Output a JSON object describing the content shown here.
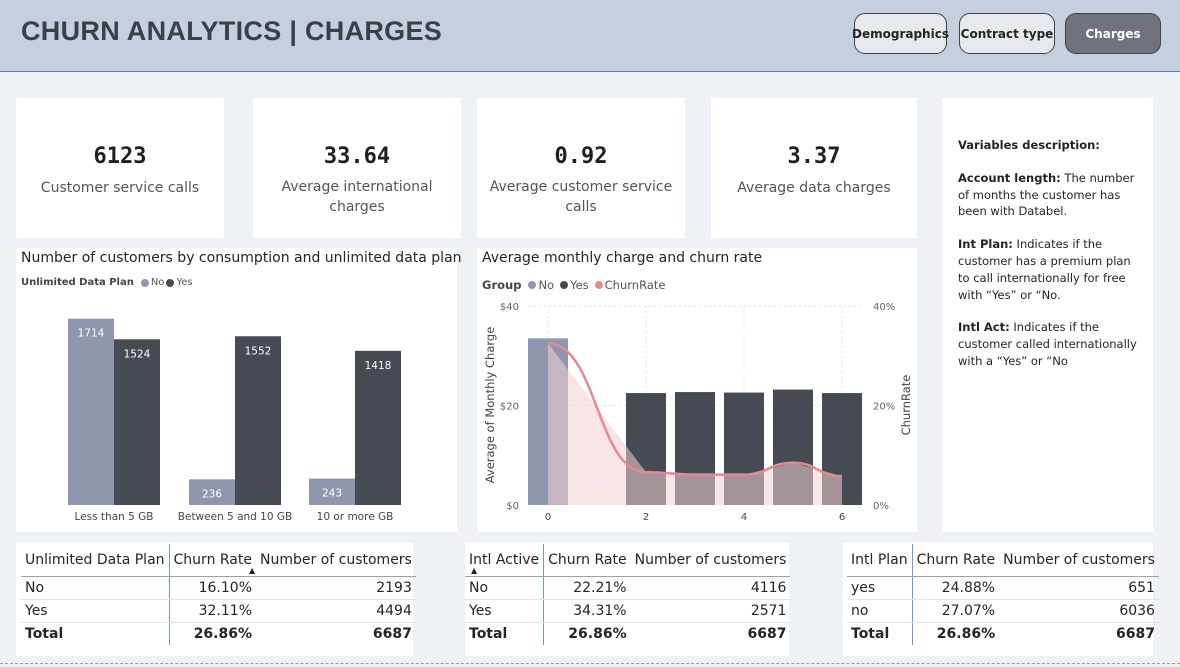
{
  "header": {
    "title": "CHURN ANALYTICS | CHARGES",
    "nav": [
      {
        "label": "Demographics",
        "active": false
      },
      {
        "label": "Contract type",
        "active": false
      },
      {
        "label": "Charges",
        "active": true
      }
    ]
  },
  "kpis": [
    {
      "value": "6123",
      "label": "Customer service calls"
    },
    {
      "value": "33.64",
      "label": "Average international charges"
    },
    {
      "value": "0.92",
      "label": "Average customer service calls"
    },
    {
      "value": "3.37",
      "label": "Average data charges"
    }
  ],
  "description": {
    "heading": "Variables description:",
    "items": [
      {
        "term": "Account length:",
        "text": " The number of months the customer has been with Databel."
      },
      {
        "term": "Int Plan:",
        "text": " Indicates if the customer has a premium plan to call internationally for free with “Yes” or “No."
      },
      {
        "term": "Intl Act:",
        "text": " Indicates if the customer called internationally with a “Yes” or “No"
      }
    ]
  },
  "colors": {
    "no": "#8e97ad",
    "yes": "#464a53",
    "churn_line": "#e8898e",
    "churn_area": "#f3cfd1"
  },
  "chart_data": [
    {
      "type": "bar",
      "title": "Number of customers by consumption and unlimited data plan",
      "legend_title": "Unlimited Data Plan",
      "legend_position": "top-left",
      "categories": [
        "Less than 5 GB",
        "Between 5 and 10 GB",
        "10 or more GB"
      ],
      "series": [
        {
          "name": "No",
          "values": [
            1714,
            236,
            243
          ]
        },
        {
          "name": "Yes",
          "values": [
            1524,
            1552,
            1418
          ]
        }
      ],
      "ylim": [
        0,
        1950
      ],
      "grid": false
    },
    {
      "type": "bar",
      "title": "Average monthly charge and churn rate",
      "legend_title": "Group",
      "legend_position": "top-left",
      "ylabel": "Average of Monthly Charge",
      "y2label": "ChurnRate",
      "x_ticks": [
        "0",
        "2",
        "4",
        "6"
      ],
      "y_ticks": [
        "$0",
        "$20",
        "$40"
      ],
      "y2_ticks": [
        "0%",
        "20%",
        "40%"
      ],
      "x": [
        0,
        2,
        3,
        4,
        5,
        6
      ],
      "series": [
        {
          "name": "No",
          "x": [
            0
          ],
          "values": [
            33.5
          ]
        },
        {
          "name": "Yes",
          "x": [
            2,
            3,
            4,
            5,
            6
          ],
          "values": [
            22.5,
            22.7,
            22.6,
            23.2,
            22.5
          ]
        },
        {
          "name": "ChurnRate",
          "type": "area-line",
          "axis": "secondary",
          "x": [
            0,
            2,
            3,
            4,
            5,
            6
          ],
          "values": [
            32.5,
            6.6,
            6.1,
            6.1,
            8.5,
            5.8
          ]
        }
      ],
      "ylim": [
        0,
        40
      ],
      "y2lim": [
        0,
        40
      ],
      "grid": true
    }
  ],
  "tables": [
    {
      "columns": [
        "Unlimited Data Plan",
        "Churn Rate",
        "Number of customers"
      ],
      "rows": [
        [
          "No",
          "16.10%",
          "2193"
        ],
        [
          "Yes",
          "32.11%",
          "4494"
        ]
      ],
      "total": [
        "Total",
        "26.86%",
        "6687"
      ]
    },
    {
      "columns": [
        "Intl Active",
        "Churn Rate",
        "Number of customers"
      ],
      "rows": [
        [
          "No",
          "22.21%",
          "4116"
        ],
        [
          "Yes",
          "34.31%",
          "2571"
        ]
      ],
      "total": [
        "Total",
        "26.86%",
        "6687"
      ]
    },
    {
      "columns": [
        "Intl Plan",
        "Churn Rate",
        "Number of customers"
      ],
      "rows": [
        [
          "yes",
          "24.88%",
          "651"
        ],
        [
          "no",
          "27.07%",
          "6036"
        ]
      ],
      "total": [
        "Total",
        "26.86%",
        "6687"
      ]
    }
  ],
  "sort_indicator": "▲"
}
